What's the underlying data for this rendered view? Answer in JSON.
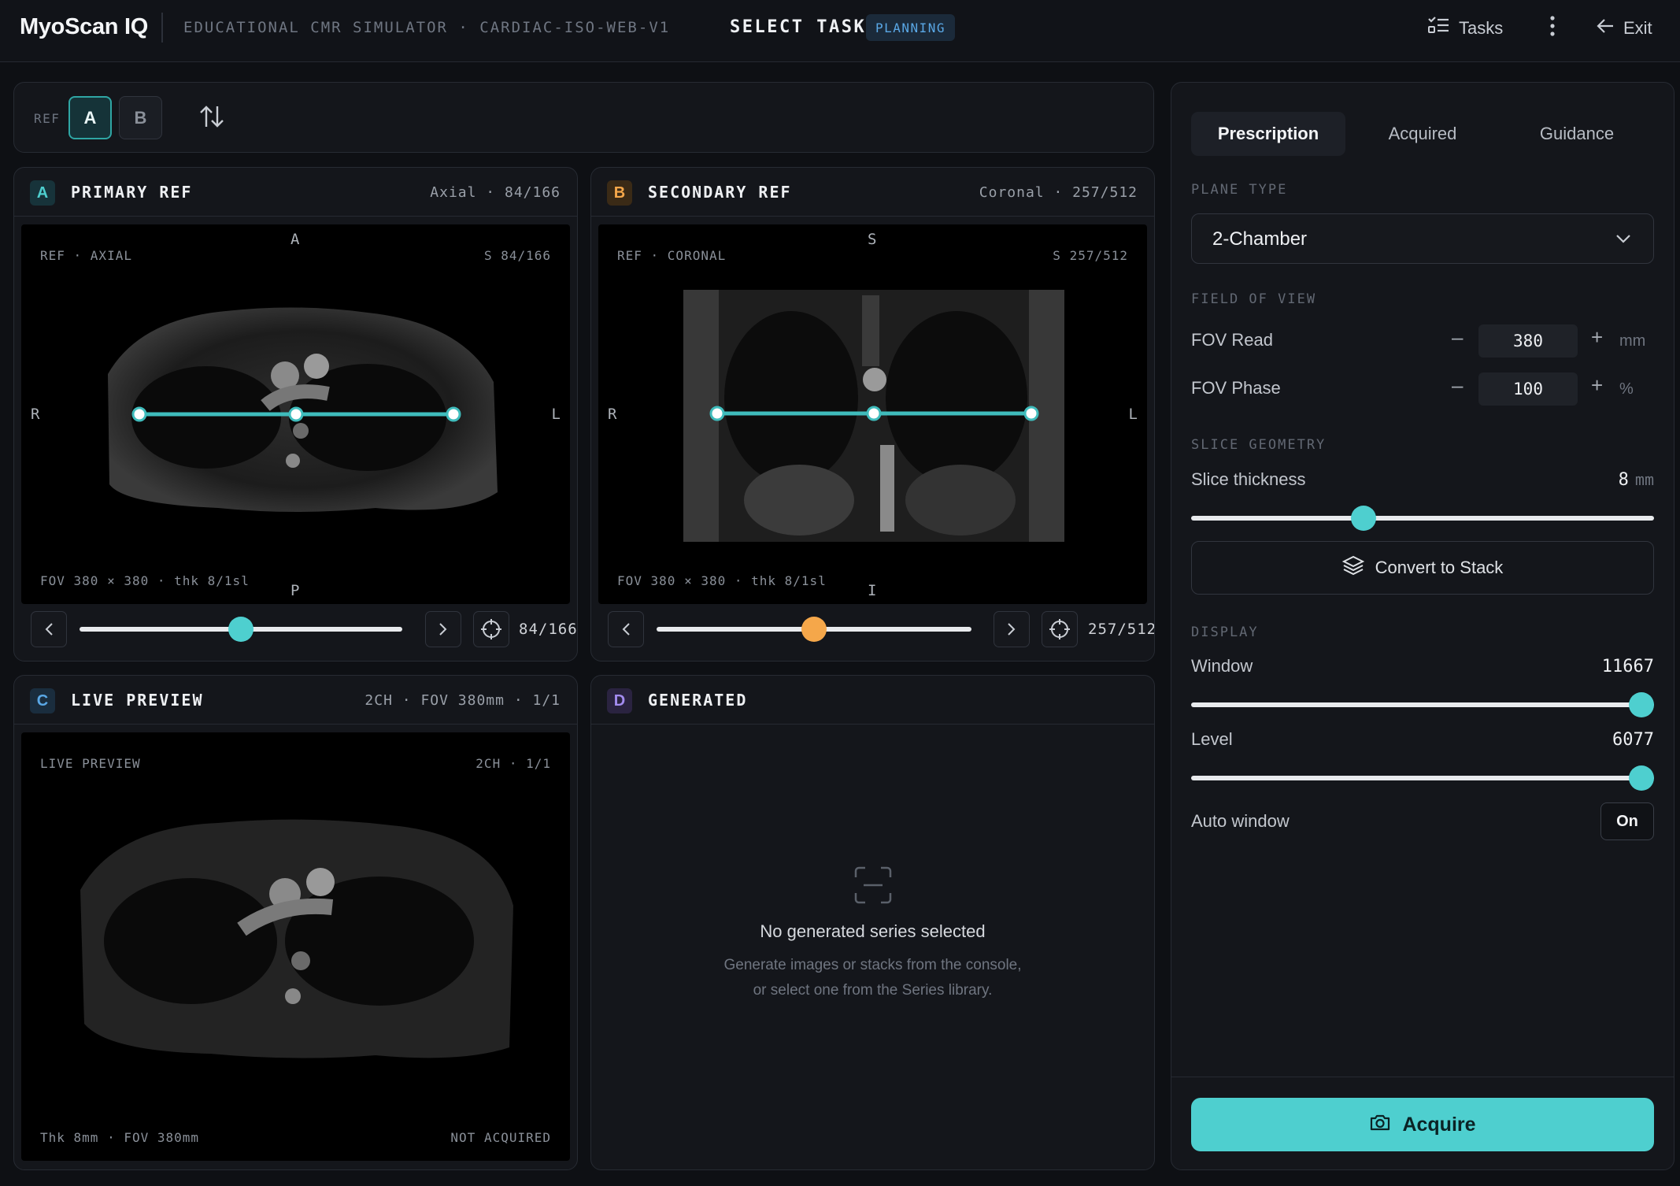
{
  "app": {
    "brand": "MyoScan IQ",
    "subtitle": "EDUCATIONAL CMR SIMULATOR · CARDIAC-ISO-WEB-V1",
    "task_title": "SELECT TASK",
    "status": "PLANNING",
    "tasks_label": "Tasks",
    "exit_label": "Exit"
  },
  "ref_toolbar": {
    "label": "REF",
    "options": [
      "A",
      "B"
    ],
    "selected": "A"
  },
  "viewers": {
    "a": {
      "badge": "A",
      "title": "PRIMARY REF",
      "meta": "Axial · 84/166",
      "overlay_tl": "REF · AXIAL",
      "overlay_tr": "S 84/166",
      "overlay_bl": "FOV 380 × 380 · thk 8/1sl",
      "orient_top": "A",
      "orient_bottom": "P",
      "orient_left": "R",
      "orient_right": "L",
      "slice_value": "84/166",
      "slice_fraction": 0.5
    },
    "b": {
      "badge": "B",
      "title": "SECONDARY REF",
      "meta": "Coronal · 257/512",
      "overlay_tl": "REF · CORONAL",
      "overlay_tr": "S 257/512",
      "overlay_bl": "FOV 380 × 380 · thk 8/1sl",
      "orient_top": "S",
      "orient_bottom": "I",
      "orient_left": "R",
      "orient_right": "L",
      "slice_value": "257/512",
      "slice_fraction": 0.5
    },
    "c": {
      "badge": "C",
      "title": "LIVE PREVIEW",
      "meta": "2CH · FOV 380mm · 1/1",
      "overlay_tl": "LIVE PREVIEW",
      "overlay_tr": "2CH · 1/1",
      "overlay_bl": "Thk 8mm · FOV 380mm",
      "overlay_br": "NOT ACQUIRED"
    },
    "d": {
      "badge": "D",
      "title": "GENERATED",
      "empty_title": "No generated series selected",
      "empty_body": "Generate images or stacks from the console, or select one from the Series library."
    }
  },
  "side": {
    "tabs": [
      "Prescription",
      "Acquired",
      "Guidance"
    ],
    "active_tab": "Prescription",
    "plane_type_label": "PLANE TYPE",
    "plane_type": "2-Chamber",
    "fov_section": "FIELD OF VIEW",
    "fov_read_label": "FOV Read",
    "fov_read": "380",
    "fov_read_unit": "mm",
    "fov_phase_label": "FOV Phase",
    "fov_phase": "100",
    "fov_phase_unit": "%",
    "slice_section": "SLICE GEOMETRY",
    "slice_thickness_label": "Slice thickness",
    "slice_thickness": "8",
    "slice_thickness_unit": "mm",
    "convert_label": "Convert to Stack",
    "display_section": "DISPLAY",
    "window_label": "Window",
    "window_value": "11667",
    "level_label": "Level",
    "level_value": "6077",
    "auto_window_label": "Auto window",
    "auto_window_state": "On",
    "acquire_label": "Acquire"
  },
  "colors": {
    "accent": "#4ecfcf",
    "secondary": "#f5a74a",
    "plan_line": "#3fbcbc"
  }
}
